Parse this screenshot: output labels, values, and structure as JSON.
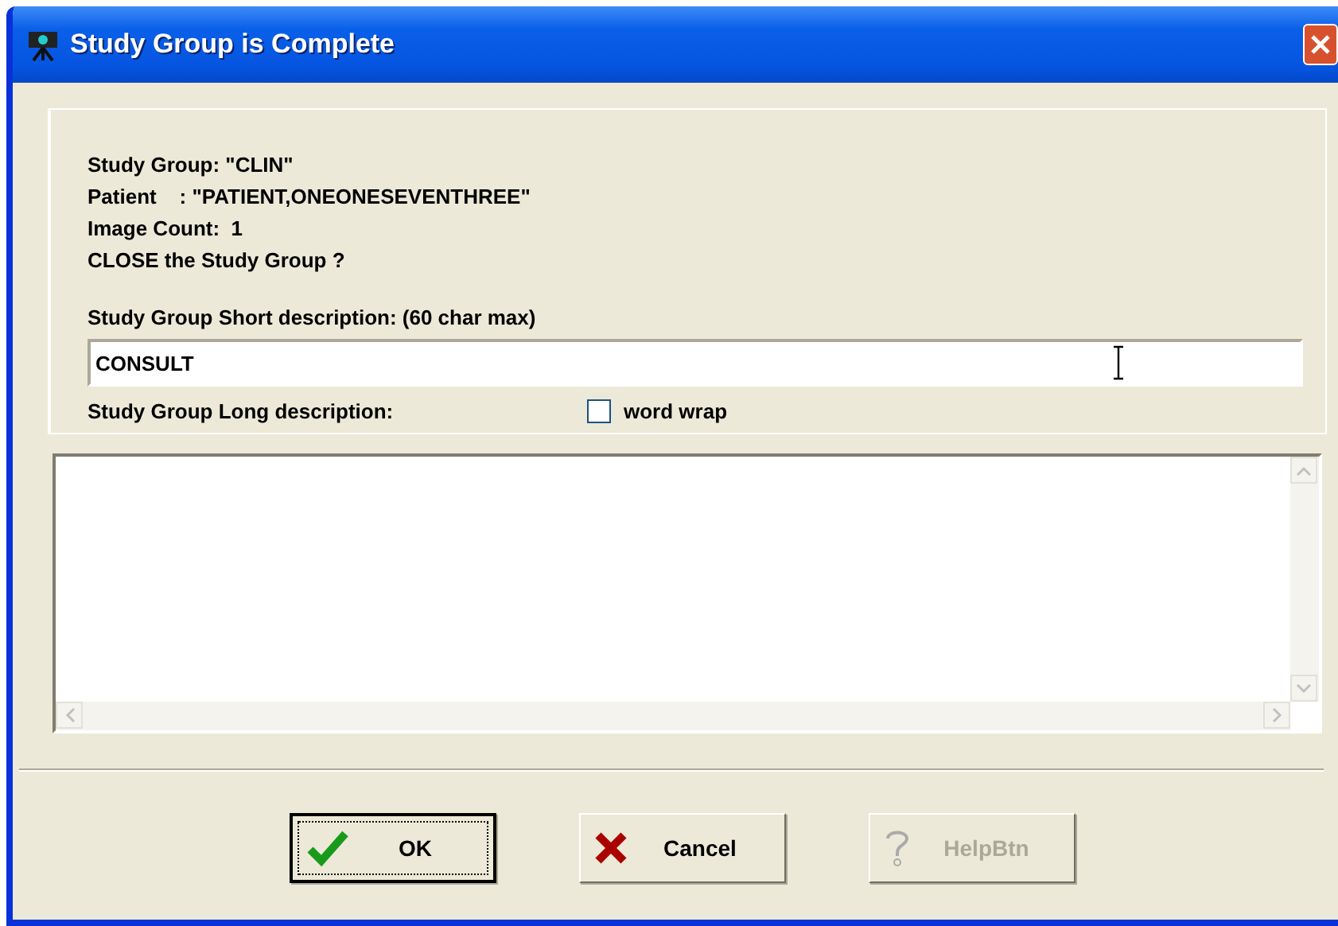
{
  "window": {
    "title": "Study Group is Complete"
  },
  "info_lines": [
    "Study Group: \"CLIN\"",
    "Patient    : \"PATIENT,ONEONESEVENTHREE\"",
    "Image Count:  1",
    "CLOSE the Study Group ?"
  ],
  "short_description": {
    "label": "Study Group Short description: (60 char max)",
    "value": "CONSULT"
  },
  "long_description": {
    "label": "Study Group Long description:"
  },
  "word_wrap": {
    "label": "word wrap",
    "checked": false
  },
  "buttons": [
    {
      "kind": "ok",
      "label": "OK",
      "default": true,
      "disabled": false
    },
    {
      "kind": "cancel",
      "label": "Cancel",
      "default": false,
      "disabled": false
    },
    {
      "kind": "help",
      "label": "HelpBtn",
      "default": false,
      "disabled": true
    }
  ]
}
